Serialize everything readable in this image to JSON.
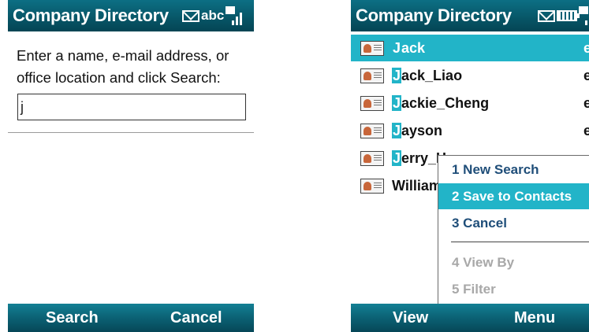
{
  "left_screen": {
    "title": "Company Directory",
    "status_abc": "abc",
    "prompt": "Enter a name, e-mail address, or office location and click Search:",
    "search_value": "j",
    "softkeys": {
      "left": "Search",
      "right": "Cancel"
    }
  },
  "right_screen": {
    "title": "Company Directory",
    "results": [
      {
        "highlight": "J",
        "rest": "ack",
        "col2": "e",
        "selected": true
      },
      {
        "highlight": "J",
        "rest": "ack_Liao",
        "col2": "e",
        "selected": false
      },
      {
        "highlight": "J",
        "rest": "ackie_Cheng",
        "col2": "e",
        "selected": false
      },
      {
        "highlight": "J",
        "rest": "ayson",
        "col2": "e",
        "selected": false
      },
      {
        "highlight": "J",
        "rest": "erry_H",
        "col2": "",
        "selected": false
      },
      {
        "highlight": "",
        "rest": "William",
        "col2": "",
        "selected": false
      }
    ],
    "menu": [
      {
        "label": "1 New Search",
        "selected": false,
        "disabled": false
      },
      {
        "label": "2 Save to Contacts",
        "selected": true,
        "disabled": false
      },
      {
        "label": "3 Cancel",
        "selected": false,
        "disabled": false
      },
      {
        "label": "4 View By",
        "selected": false,
        "disabled": true,
        "submenu": true
      },
      {
        "label": "5 Filter",
        "selected": false,
        "disabled": true,
        "submenu": true
      }
    ],
    "softkeys": {
      "left": "View",
      "right": "Menu"
    }
  },
  "colors": {
    "titlebar": "#075566",
    "selection": "#22b4c8",
    "menu_text": "#1f4e79"
  },
  "icons": [
    "mail-icon",
    "battery-icon",
    "signal-icon",
    "contact-card-icon",
    "submenu-arrow-icon"
  ]
}
